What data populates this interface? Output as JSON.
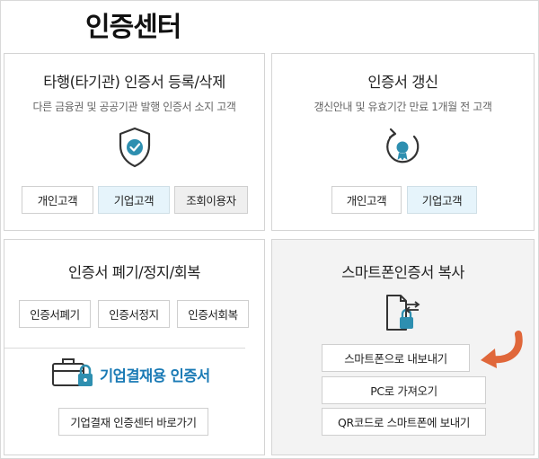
{
  "page": {
    "title": "인증센터"
  },
  "panels": {
    "register": {
      "title": "타행(타기관) 인증서 등록/삭제",
      "subtitle": "다른 금융권 및 공공기관 발행 인증서 소지 고객",
      "icon": "shield-check-icon",
      "buttons": [
        "개인고객",
        "기업고객",
        "조회이용자"
      ]
    },
    "renew": {
      "title": "인증서 갱신",
      "subtitle": "갱신안내 및 유효기간 만료 1개월 전 고객",
      "icon": "renew-certificate-icon",
      "buttons": [
        "개인고객",
        "기업고객"
      ]
    },
    "manage": {
      "title": "인증서 폐기/정지/회복",
      "buttons": [
        "인증서폐기",
        "인증서정지",
        "인증서회복"
      ],
      "corporate": {
        "label": "기업결재용 인증서",
        "icon": "briefcase-lock-icon",
        "button": "기업결재 인증센터 바로가기"
      }
    },
    "smartphone": {
      "title": "스마트폰인증서 복사",
      "icon": "phone-transfer-lock-icon",
      "buttons": [
        "스마트폰으로 내보내기",
        "PC로 가져오기",
        "QR코드로 스마트폰에 보내기"
      ],
      "pointer_icon": "curved-arrow-icon"
    }
  },
  "colors": {
    "accent_blue": "#1a7ab5",
    "button_blue_bg": "#e6f4fb",
    "arrow_orange": "#e0673a",
    "icon_teal": "#2e8fb0"
  }
}
